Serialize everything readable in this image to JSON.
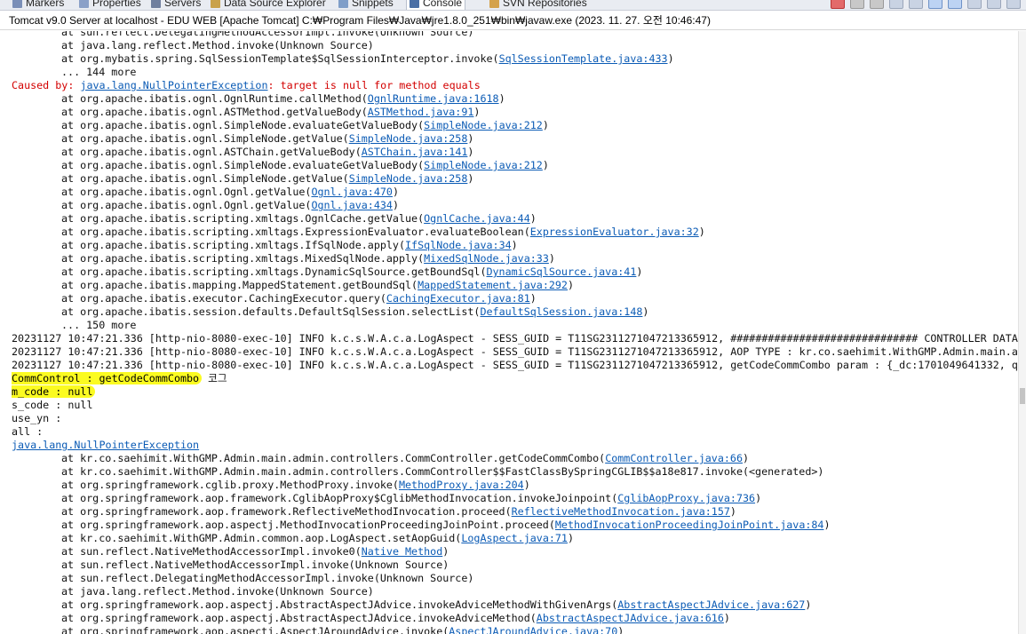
{
  "tabs": [
    {
      "label": "Markers",
      "icon": "markers-icon",
      "color": "#7a8fb8"
    },
    {
      "label": "Properties",
      "icon": "properties-icon",
      "color": "#8aa0c8"
    },
    {
      "label": "Servers",
      "icon": "servers-icon",
      "color": "#6f7f9e"
    },
    {
      "label": "Data Source Explorer",
      "icon": "data-source-icon",
      "color": "#c9a24a"
    },
    {
      "label": "Snippets",
      "icon": "snippets-icon",
      "color": "#7f9ec9"
    },
    {
      "label": "Console",
      "icon": "console-icon",
      "color": "#4a6fa5",
      "active": true
    },
    {
      "label": "SVN Repositories",
      "icon": "svn-icon",
      "color": "#d4a24c"
    }
  ],
  "toolbar": {
    "buttons": [
      "terminate-icon",
      "remove-launch-icon",
      "remove-all-icon",
      "clear-console-icon",
      "scroll-lock-icon",
      "word-wrap-icon",
      "pin-console-icon",
      "display-selected-icon",
      "open-console-icon",
      "minimize-icon"
    ]
  },
  "title": "Tomcat v9.0 Server at localhost - EDU WEB [Apache Tomcat] C:₩Program Files₩Java₩jre1.8.0_251₩bin₩javaw.exe  (2023. 11. 27. 오전 10:46:47)",
  "console": {
    "lines": [
      {
        "indent": true,
        "text": "at sun.reflect.DelegatingMethodAccessorImpl.invoke(Unknown Source)"
      },
      {
        "indent": true,
        "text": "at java.lang.reflect.Method.invoke(Unknown Source)"
      },
      {
        "indent": true,
        "text": "at org.mybatis.spring.SqlSessionTemplate$SqlSessionInterceptor.invoke(",
        "link": "SqlSessionTemplate.java:433",
        "after": ")"
      },
      {
        "indent": true,
        "text": "... 144 more"
      },
      {
        "err": true,
        "text": "Caused by: ",
        "link": "java.lang.NullPointerException",
        "after": ": target is null for method equals"
      },
      {
        "indent": true,
        "text": "at org.apache.ibatis.ognl.OgnlRuntime.callMethod(",
        "link": "OgnlRuntime.java:1618",
        "after": ")"
      },
      {
        "indent": true,
        "text": "at org.apache.ibatis.ognl.ASTMethod.getValueBody(",
        "link": "ASTMethod.java:91",
        "after": ")"
      },
      {
        "indent": true,
        "text": "at org.apache.ibatis.ognl.SimpleNode.evaluateGetValueBody(",
        "link": "SimpleNode.java:212",
        "after": ")"
      },
      {
        "indent": true,
        "text": "at org.apache.ibatis.ognl.SimpleNode.getValue(",
        "link": "SimpleNode.java:258",
        "after": ")"
      },
      {
        "indent": true,
        "text": "at org.apache.ibatis.ognl.ASTChain.getValueBody(",
        "link": "ASTChain.java:141",
        "after": ")"
      },
      {
        "indent": true,
        "text": "at org.apache.ibatis.ognl.SimpleNode.evaluateGetValueBody(",
        "link": "SimpleNode.java:212",
        "after": ")"
      },
      {
        "indent": true,
        "text": "at org.apache.ibatis.ognl.SimpleNode.getValue(",
        "link": "SimpleNode.java:258",
        "after": ")"
      },
      {
        "indent": true,
        "text": "at org.apache.ibatis.ognl.Ognl.getValue(",
        "link": "Ognl.java:470",
        "after": ")"
      },
      {
        "indent": true,
        "text": "at org.apache.ibatis.ognl.Ognl.getValue(",
        "link": "Ognl.java:434",
        "after": ")"
      },
      {
        "indent": true,
        "text": "at org.apache.ibatis.scripting.xmltags.OgnlCache.getValue(",
        "link": "OgnlCache.java:44",
        "after": ")"
      },
      {
        "indent": true,
        "text": "at org.apache.ibatis.scripting.xmltags.ExpressionEvaluator.evaluateBoolean(",
        "link": "ExpressionEvaluator.java:32",
        "after": ")"
      },
      {
        "indent": true,
        "text": "at org.apache.ibatis.scripting.xmltags.IfSqlNode.apply(",
        "link": "IfSqlNode.java:34",
        "after": ")"
      },
      {
        "indent": true,
        "text": "at org.apache.ibatis.scripting.xmltags.MixedSqlNode.apply(",
        "link": "MixedSqlNode.java:33",
        "after": ")"
      },
      {
        "indent": true,
        "text": "at org.apache.ibatis.scripting.xmltags.DynamicSqlSource.getBoundSql(",
        "link": "DynamicSqlSource.java:41",
        "after": ")"
      },
      {
        "indent": true,
        "text": "at org.apache.ibatis.mapping.MappedStatement.getBoundSql(",
        "link": "MappedStatement.java:292",
        "after": ")"
      },
      {
        "indent": true,
        "text": "at org.apache.ibatis.executor.CachingExecutor.query(",
        "link": "CachingExecutor.java:81",
        "after": ")"
      },
      {
        "indent": true,
        "text": "at org.apache.ibatis.session.defaults.DefaultSqlSession.selectList(",
        "link": "DefaultSqlSession.java:148",
        "after": ")"
      },
      {
        "indent": true,
        "text": "... 150 more"
      },
      {
        "text": "20231127 10:47:21.336 [http-nio-8080-exec-10] INFO k.c.s.W.A.c.a.LogAspect - SESS_GUID = T11SG2311271047213365912, ############################## CONTROLLER DATA"
      },
      {
        "text": "20231127 10:47:21.336 [http-nio-8080-exec-10] INFO k.c.s.W.A.c.a.LogAspect - SESS_GUID = T11SG2311271047213365912, AOP TYPE : kr.co.saehimit.WithGMP.Admin.main.ad"
      },
      {
        "text": "20231127 10:47:21.336 [http-nio-8080-exec-10] INFO k.c.s.W.A.c.a.LogAspect - SESS_GUID = T11SG2311271047213365912, getCodeCommCombo param : {_dc:1701049641332, qu"
      },
      {
        "hl": "CommControl : getCodeCommCombo",
        "after": " 코그",
        "round": true
      },
      {
        "hl": "m_code : null",
        "round": true
      },
      {
        "text": "s_code : null"
      },
      {
        "text": "use_yn :"
      },
      {
        "text": "all :"
      },
      {
        "link": "java.lang.NullPointerException"
      },
      {
        "indent": true,
        "text": "at kr.co.saehimit.WithGMP.Admin.main.admin.controllers.CommController.getCodeCommCombo(",
        "link": "CommController.java:66",
        "after": ")"
      },
      {
        "indent": true,
        "text": "at kr.co.saehimit.WithGMP.Admin.main.admin.controllers.CommController$$FastClassBySpringCGLIB$$a18e817.invoke(<generated>)"
      },
      {
        "indent": true,
        "text": "at org.springframework.cglib.proxy.MethodProxy.invoke(",
        "link": "MethodProxy.java:204",
        "after": ")"
      },
      {
        "indent": true,
        "text": "at org.springframework.aop.framework.CglibAopProxy$CglibMethodInvocation.invokeJoinpoint(",
        "link": "CglibAopProxy.java:736",
        "after": ")"
      },
      {
        "indent": true,
        "text": "at org.springframework.aop.framework.ReflectiveMethodInvocation.proceed(",
        "link": "ReflectiveMethodInvocation.java:157",
        "after": ")"
      },
      {
        "indent": true,
        "text": "at org.springframework.aop.aspectj.MethodInvocationProceedingJoinPoint.proceed(",
        "link": "MethodInvocationProceedingJoinPoint.java:84",
        "after": ")"
      },
      {
        "indent": true,
        "text": "at kr.co.saehimit.WithGMP.Admin.common.aop.LogAspect.setAopGuid(",
        "link": "LogAspect.java:71",
        "after": ")"
      },
      {
        "indent": true,
        "text": "at sun.reflect.NativeMethodAccessorImpl.invoke0(",
        "link": "Native Method",
        "after": ")"
      },
      {
        "indent": true,
        "text": "at sun.reflect.NativeMethodAccessorImpl.invoke(Unknown Source)"
      },
      {
        "indent": true,
        "text": "at sun.reflect.DelegatingMethodAccessorImpl.invoke(Unknown Source)"
      },
      {
        "indent": true,
        "text": "at java.lang.reflect.Method.invoke(Unknown Source)"
      },
      {
        "indent": true,
        "text": "at org.springframework.aop.aspectj.AbstractAspectJAdvice.invokeAdviceMethodWithGivenArgs(",
        "link": "AbstractAspectJAdvice.java:627",
        "after": ")"
      },
      {
        "indent": true,
        "text": "at org.springframework.aop.aspectj.AbstractAspectJAdvice.invokeAdviceMethod(",
        "link": "AbstractAspectJAdvice.java:616",
        "after": ")"
      },
      {
        "indent": true,
        "text": "at org.springframework.aop.aspectj.AspectJAroundAdvice.invoke(",
        "link": "AspectJAroundAdvice.java:70",
        "after": ")"
      }
    ]
  },
  "colors": {
    "error": "#d30000",
    "link": "#0b5bb5",
    "highlight": "#fbfb21"
  }
}
